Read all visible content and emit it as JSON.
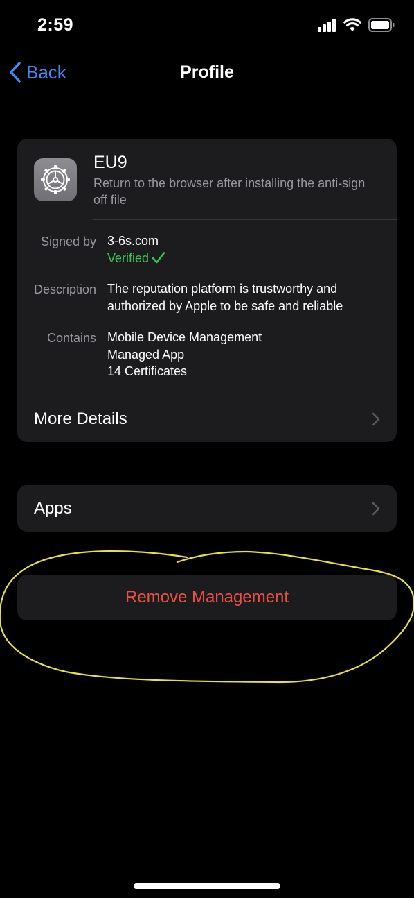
{
  "status_bar": {
    "time": "2:59"
  },
  "nav": {
    "back_label": "Back",
    "title": "Profile"
  },
  "profile": {
    "name": "EU9",
    "subtitle": "Return to the browser after installing the anti-sign off file",
    "icon": "gear-icon",
    "signed_by_label": "Signed by",
    "signed_by_value": "3-6s.com",
    "verified_label": "Verified",
    "description_label": "Description",
    "description_line1": "The reputation platform is trustworthy and",
    "description_line2": "authorized by Apple to be safe and reliable",
    "contains_label": "Contains",
    "contains": [
      "Mobile Device Management",
      "Managed App",
      "14 Certificates"
    ],
    "more_details_label": "More Details"
  },
  "apps": {
    "label": "Apps"
  },
  "remove": {
    "label": "Remove Management"
  },
  "colors": {
    "accent_blue": "#3d8bf7",
    "verified_green": "#34c759",
    "destructive_red": "#eb4f45",
    "annotation_yellow": "#e8e23a",
    "card_bg": "#1c1c1e"
  }
}
